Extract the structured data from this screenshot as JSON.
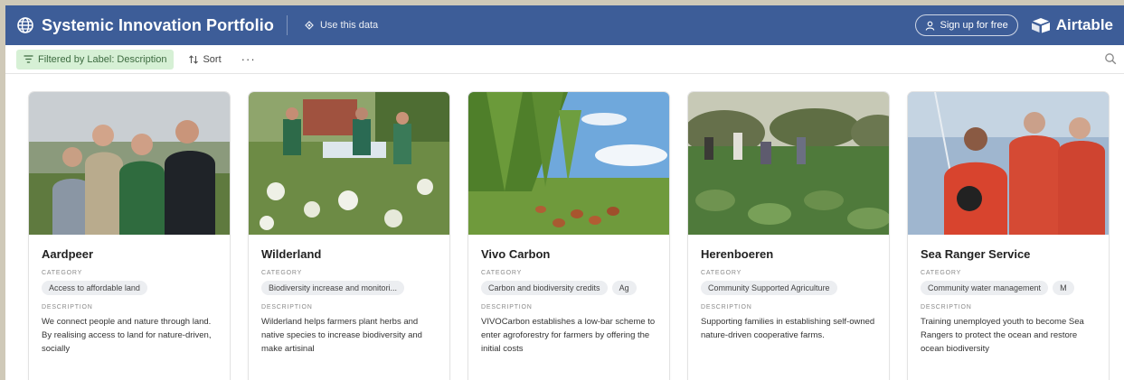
{
  "header": {
    "title": "Systemic Innovation Portfolio",
    "use_data_label": "Use this data",
    "signup_label": "Sign up for free",
    "brand": "Airtable",
    "brand_color": "#3d5d98"
  },
  "toolbar": {
    "filter_label": "Filtered by Label: Description",
    "sort_label": "Sort",
    "more_label": "···"
  },
  "labels": {
    "category": "CATEGORY",
    "description": "DESCRIPTION"
  },
  "cards": [
    {
      "title": "Aardpeer",
      "categories": [
        "Access to affordable land"
      ],
      "description": "We connect people and nature through land. By realising access to land for nature-driven, socially",
      "image": "group of four people standing in a field"
    },
    {
      "title": "Wilderland",
      "categories": [
        "Biodiversity increase and monitori..."
      ],
      "description": "Wilderland helps farmers plant herbs and native species to increase biodiversity and make artisinal",
      "image": "people harvesting among flowering herbs"
    },
    {
      "title": "Vivo Carbon",
      "categories": [
        "Carbon and biodiversity credits",
        "Ag"
      ],
      "description": "VIVOCarbon establishes a low-bar scheme to enter agroforestry for farmers by offering the initial costs",
      "image": "chickens under rows of young trees"
    },
    {
      "title": "Herenboeren",
      "categories": [
        "Community Supported Agriculture"
      ],
      "description": "Supporting families in establishing self-owned nature-driven cooperative farms.",
      "image": "people working in vegetable field"
    },
    {
      "title": "Sea Ranger Service",
      "categories": [
        "Community water management",
        "M"
      ],
      "description": "Training unemployed youth to become Sea Rangers to protect the ocean and restore ocean biodiversity",
      "image": "three people in red survival suits on a boat"
    }
  ]
}
